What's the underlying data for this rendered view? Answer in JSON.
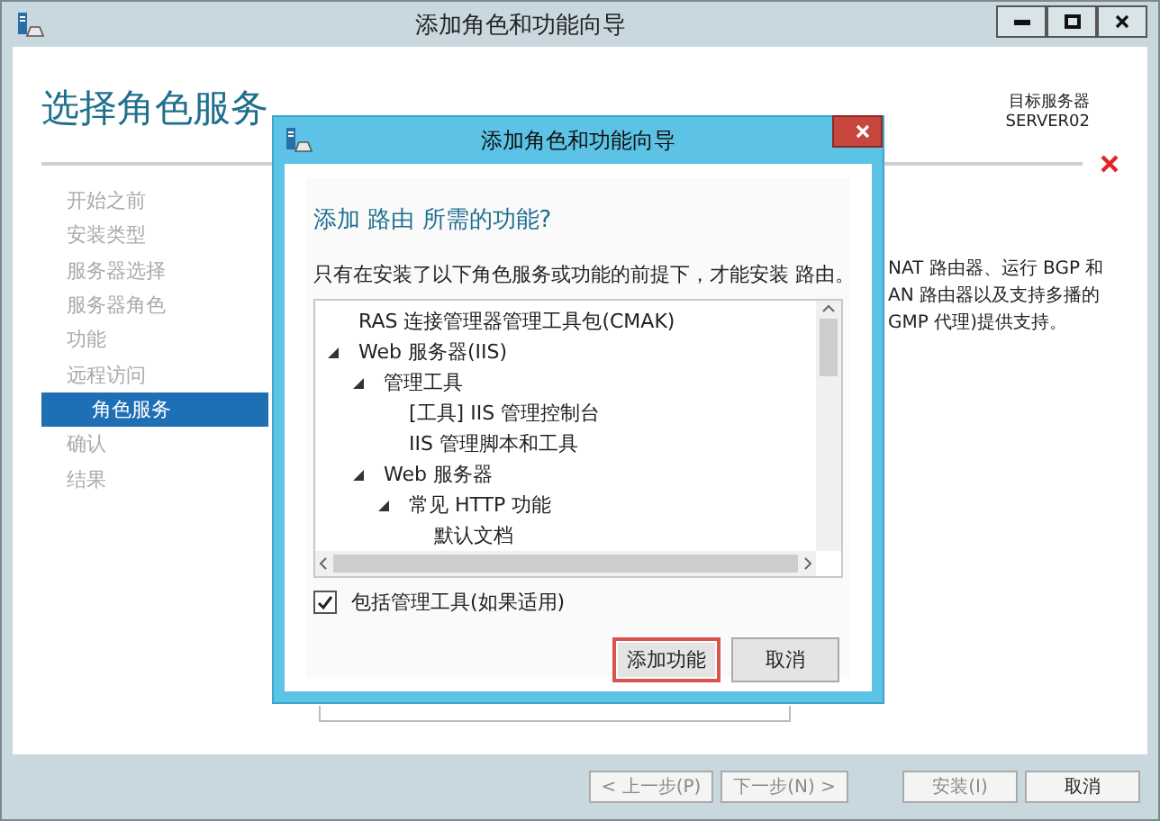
{
  "window": {
    "title": "添加角色和功能向导"
  },
  "page": {
    "title": "选择角色服务",
    "target_label": "目标服务器",
    "target_server": "SERVER02"
  },
  "nav": [
    {
      "label": "开始之前",
      "selected": false
    },
    {
      "label": "安装类型",
      "selected": false
    },
    {
      "label": "服务器选择",
      "selected": false
    },
    {
      "label": "服务器角色",
      "selected": false
    },
    {
      "label": "功能",
      "selected": false
    },
    {
      "label": "远程访问",
      "selected": false
    },
    {
      "label": "角色服务",
      "selected": true
    },
    {
      "label": "确认",
      "selected": false
    },
    {
      "label": "结果",
      "selected": false
    }
  ],
  "description": [
    "NAT 路由器、运行 BGP 和",
    "AN 路由器以及支持多播的",
    "GMP 代理)提供支持。"
  ],
  "footer_buttons": [
    {
      "label": "< 上一步(P)",
      "disabled": true
    },
    {
      "label": "下一步(N) >",
      "disabled": true
    },
    {
      "label": "安装(I)",
      "disabled": true
    },
    {
      "label": "取消",
      "disabled": false
    }
  ],
  "dialog": {
    "title": "添加角色和功能向导",
    "heading": "添加 路由 所需的功能?",
    "message": "只有在安装了以下角色服务或功能的前提下，才能安装 路由。",
    "tree": [
      {
        "label": "RAS 连接管理器管理工具包(CMAK)"
      },
      {
        "label": "Web 服务器(IIS)",
        "expanded": true,
        "children": [
          {
            "label": "管理工具",
            "expanded": true,
            "children": [
              {
                "label": "[工具] IIS 管理控制台"
              },
              {
                "label": "IIS 管理脚本和工具"
              }
            ]
          },
          {
            "label": "Web 服务器",
            "expanded": true,
            "children": [
              {
                "label": "常见 HTTP 功能",
                "expanded": true,
                "children": [
                  {
                    "label": "默认文档"
                  }
                ]
              }
            ]
          }
        ]
      }
    ],
    "include_tools": {
      "label": "包括管理工具(如果适用)",
      "checked": true
    },
    "buttons": [
      {
        "label": "添加功能",
        "highlighted": true
      },
      {
        "label": "取消",
        "highlighted": false
      }
    ]
  }
}
